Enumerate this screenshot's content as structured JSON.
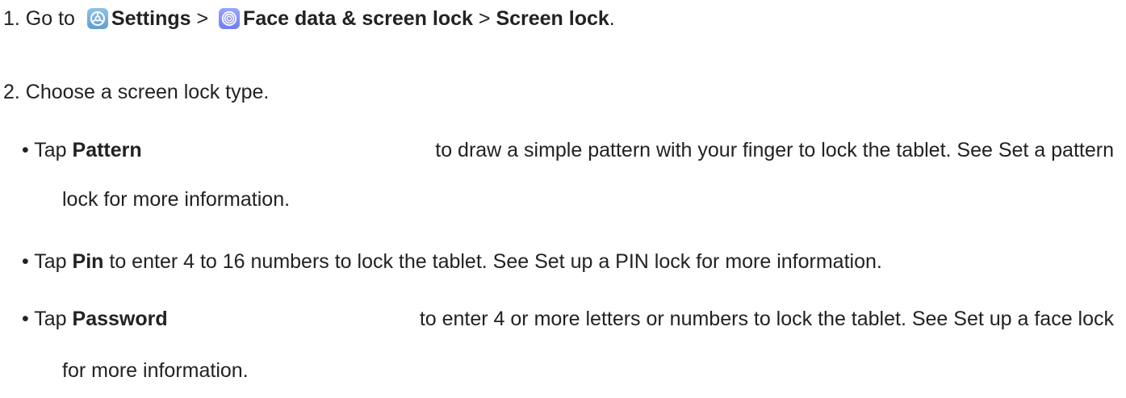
{
  "step1": {
    "prefix": "1. Go to",
    "settings_label": "Settings",
    "sep1": ">",
    "face_label": "Face data & screen lock",
    "sep2": ">",
    "screen_lock_label": "Screen lock",
    "end": ".",
    "icons": [
      "settings-icon",
      "face-data-icon"
    ]
  },
  "step2": {
    "text": "2. Choose a screen lock type."
  },
  "bullets": [
    {
      "mark": "•",
      "lead": "Tap",
      "bold": "Pattern",
      "rest_line1": "to draw a simple pattern with your finger to lock the tablet. See Set a pattern",
      "rest_line2": "lock for more information."
    },
    {
      "mark": "•",
      "lead": "Tap",
      "bold": "Pin",
      "rest_line1": "to enter 4 to 16 numbers to lock the tablet. See Set up a PIN lock for more information."
    },
    {
      "mark": "•",
      "lead": "Tap",
      "bold": "Password",
      "rest_line1": "to enter 4 or more letters or numbers to lock the tablet. See Set up a face lock",
      "rest_line2": "for more information."
    }
  ]
}
